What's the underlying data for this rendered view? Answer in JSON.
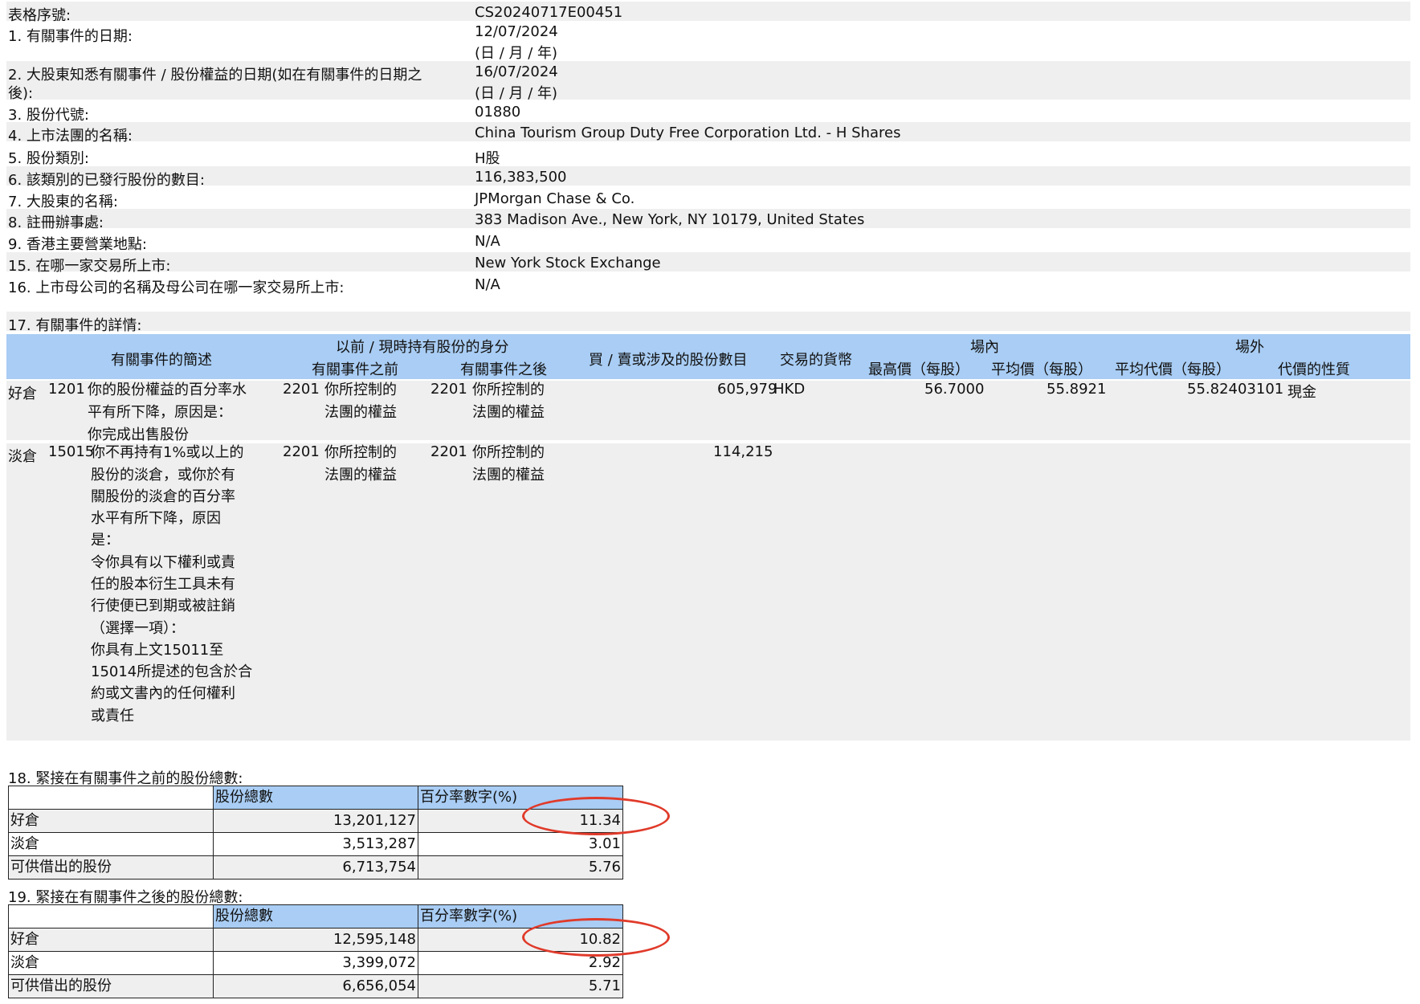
{
  "top": [
    {
      "label": "表格序號:",
      "value": "CS20240717E00451"
    },
    {
      "label": "1. 有關事件的日期:",
      "value": "12/07/2024",
      "value2": "(日 / 月 / 年)"
    },
    {
      "label": "2. 大股東知悉有關事件 / 股份權益的日期(如在有關事件的日期之",
      "label2": "後):",
      "value": "16/07/2024",
      "value2": "(日 / 月 / 年)"
    },
    {
      "label": "3. 股份代號:",
      "value": "01880"
    },
    {
      "label": "4. 上市法團的名稱:",
      "value": "China Tourism Group Duty Free Corporation Ltd. - H Shares"
    },
    {
      "label": "5. 股份類別:",
      "value": "H股"
    },
    {
      "label": "6. 該類別的已發行股份的數目:",
      "value": "116,383,500"
    },
    {
      "label": "7. 大股東的名稱:",
      "value": "JPMorgan Chase & Co."
    },
    {
      "label": "8. 註冊辦事處:",
      "value": "383 Madison Ave., New York, NY 10179, United States"
    },
    {
      "label": "9. 香港主要營業地點:",
      "value": "N/A"
    },
    {
      "label": "15. 在哪一家交易所上市:",
      "value": "New York Stock Exchange"
    },
    {
      "label": "16. 上市母公司的名稱及母公司在哪一家交易所上市:",
      "value": "N/A"
    },
    {
      "label": "17. 有關事件的詳情:"
    }
  ],
  "header": {
    "summary": "有關事件的簡述",
    "capacity": "以前 / 現時持有股份的身分",
    "before": "有關事件之前",
    "after": "有關事件之後",
    "shares": "買 / 賣或涉及的股份數目",
    "currency": "交易的貨幣",
    "onex": "場內",
    "highest": "最高價（每股）",
    "average": "平均價（每股）",
    "offex": "場外",
    "avg_consideration": "平均代價（每股）",
    "nature": "代價的性質"
  },
  "details": [
    {
      "position": "好倉",
      "code": "1201",
      "desc": [
        "你的股份權益的百分率水",
        "平有所下降，原因是：",
        "你完成出售股份"
      ],
      "before_code": "2201",
      "before_text": [
        "你所控制的",
        "法團的權益"
      ],
      "after_code": "2201",
      "after_text": [
        "你所控制的",
        "法團的權益"
      ],
      "shares": "605,979",
      "currency": "HKD",
      "highest": "56.7000",
      "average": "55.8921",
      "off_avg": "55.82403101",
      "nature": "現金"
    },
    {
      "position": "淡倉",
      "code": "15015",
      "desc": [
        "你不再持有1%或以上的",
        "股份的淡倉，或你於有",
        "關股份的淡倉的百分率",
        "水平有所下降，原因",
        "是：",
        "令你具有以下權利或責",
        "任的股本衍生工具未有",
        "行使便已到期或被註銷",
        "（選擇一項）：",
        "你具有上文15011至",
        "15014所提述的包含於合",
        "約或文書內的任何權利",
        "或責任"
      ],
      "before_code": "2201",
      "before_text": [
        "你所控制的",
        "法團的權益"
      ],
      "after_code": "2201",
      "after_text": [
        "你所控制的",
        "法團的權益"
      ],
      "shares": "114,215"
    }
  ],
  "section18": {
    "title": "18. 緊接在有關事件之前的股份總數:",
    "col1": "股份總數",
    "col2": "百分率數字(%)",
    "rows": [
      {
        "label": "好倉",
        "shares": "13,201,127",
        "pct": "11.34"
      },
      {
        "label": "淡倉",
        "shares": "3,513,287",
        "pct": "3.01"
      },
      {
        "label": "可供借出的股份",
        "shares": "6,713,754",
        "pct": "5.76"
      }
    ]
  },
  "section19": {
    "title": "19. 緊接在有關事件之後的股份總數:",
    "col1": "股份總數",
    "col2": "百分率數字(%)",
    "rows": [
      {
        "label": "好倉",
        "shares": "12,595,148",
        "pct": "10.82"
      },
      {
        "label": "淡倉",
        "shares": "3,399,072",
        "pct": "2.92"
      },
      {
        "label": "可供借出的股份",
        "shares": "6,656,054",
        "pct": "5.71"
      }
    ]
  },
  "annotation_color": "#e03a2a"
}
